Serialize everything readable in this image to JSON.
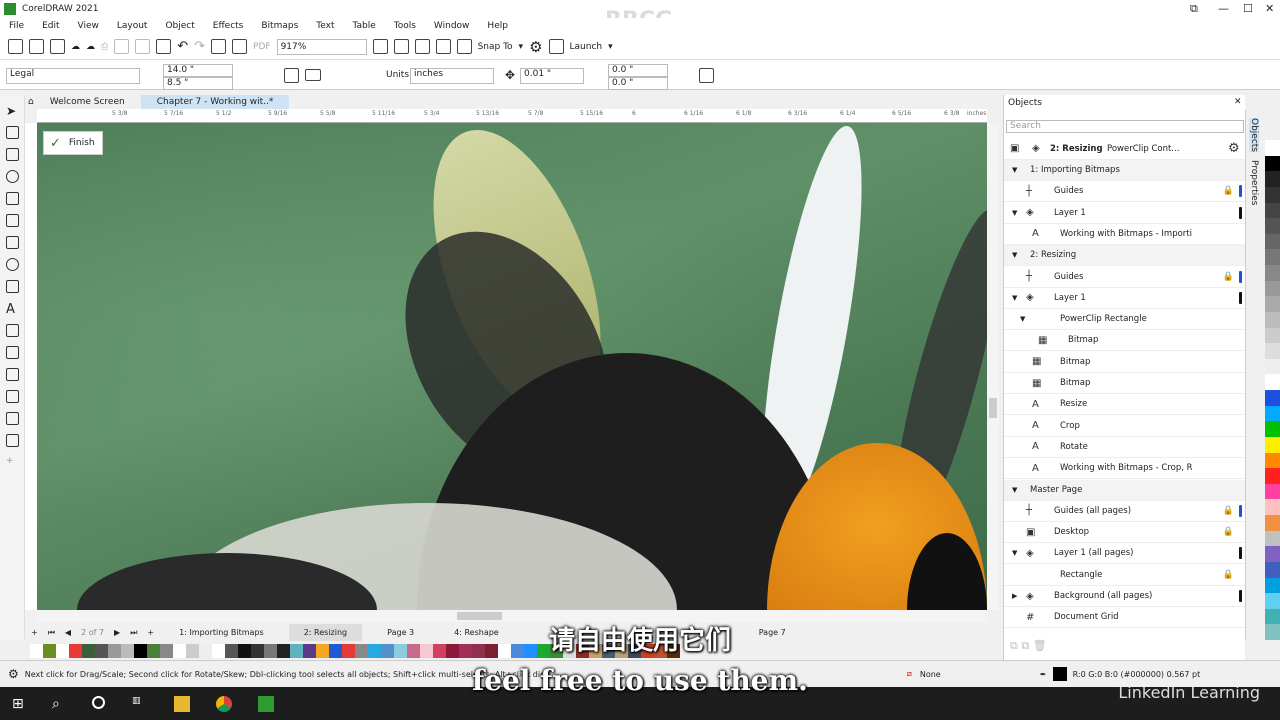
{
  "app": {
    "title": "CorelDRAW 2021",
    "watermark_top": "RRCG"
  },
  "menu": [
    "File",
    "Edit",
    "View",
    "Layout",
    "Object",
    "Effects",
    "Bitmaps",
    "Text",
    "Table",
    "Tools",
    "Window",
    "Help"
  ],
  "toolbar": {
    "zoom": "917%",
    "snap_to": "Snap To",
    "launch": "Launch"
  },
  "property_bar": {
    "page_size": "Legal",
    "width": "14.0 \"",
    "height": "8.5 \"",
    "units_label": "Units:",
    "units": "inches",
    "nudge": "0.01 \"",
    "dup_x": "0.0 \"",
    "dup_y": "0.0 \""
  },
  "doc_tabs": [
    "Welcome Screen",
    "Chapter 7 - Working wit..*"
  ],
  "ruler": [
    "5 3/8",
    "5 7/16",
    "5 1/2",
    "5 9/16",
    "5 5/8",
    "5 11/16",
    "5 3/4",
    "5 13/16",
    "5 7/8",
    "5 15/16",
    "6",
    "6 1/16",
    "6 1/8",
    "6 3/16",
    "6 1/4",
    "6 5/16",
    "6 3/8",
    "inches"
  ],
  "finish_button": "Finish",
  "pages": {
    "counter": "2 of 7",
    "tabs": [
      "1: Importing Bitmaps",
      "2: Resizing",
      "Page 3",
      "4: Reshape",
      "Page 7"
    ],
    "current": 1
  },
  "palette": [
    "#ffffff",
    "#6b8e23",
    "#ffffff",
    "#e53935",
    "#3a5f3a",
    "#555555",
    "#999999",
    "#bbbbbb",
    "#000000",
    "#4a7f3a",
    "#888888",
    "#ffffff",
    "#cccccc",
    "#eeeeee",
    "#ffffff",
    "#555555",
    "#111111",
    "#333333",
    "#777777",
    "#222222",
    "#5fb3c0",
    "#5b3a8a",
    "#f5a623",
    "#1e5ad8",
    "#e53935",
    "#888888",
    "#29a8e0",
    "#5590c8",
    "#88ccdd",
    "#c86b8a",
    "#f8c8d0",
    "#d04060",
    "#8b1a3a",
    "#a0305a",
    "#903050",
    "#7a2030",
    "#ffffff",
    "#4a8ad8",
    "#1e90ff",
    "#1fa830",
    "#3a8a3a",
    "#dddddd",
    "#8b2a2a",
    "#c8a060",
    "#4a5a70",
    "#b8a070",
    "#3a4a5a",
    "#d04020",
    "#c05030",
    "#5a2a10"
  ],
  "status": {
    "hint": "Next click for Drag/Scale; Second click for Rotate/Skew; Dbl-clicking tool selects all objects; Shift+click multi-selects; Alt+click digs",
    "fill": "None",
    "outline": "R:0 G:0 B:0 (#000000)  0.567 pt"
  },
  "objects_panel": {
    "title": "Objects",
    "search_placeholder": "Search",
    "current_page": "2: Resizing",
    "current_object": "PowerClip Cont...",
    "rows": [
      {
        "label": "1: Importing Bitmaps",
        "level": 0,
        "type": "page",
        "expand": "▼"
      },
      {
        "label": "Guides",
        "level": 1,
        "type": "guides",
        "bar": "#1e50e0",
        "lock": true
      },
      {
        "label": "Layer 1",
        "level": 1,
        "type": "layer",
        "expand": "▼",
        "bar": "#111111"
      },
      {
        "label": "Working with Bitmaps - Importi",
        "level": 2,
        "type": "text"
      },
      {
        "label": "2: Resizing",
        "level": 0,
        "type": "page",
        "expand": "▼"
      },
      {
        "label": "Guides",
        "level": 1,
        "type": "guides",
        "bar": "#1e50e0",
        "lock": true
      },
      {
        "label": "Layer 1",
        "level": 1,
        "type": "layer",
        "expand": "▼",
        "bar": "#111111"
      },
      {
        "label": "PowerClip Rectangle",
        "level": 2,
        "type": "none",
        "expand": "▼"
      },
      {
        "label": "Bitmap",
        "level": 3,
        "type": "bitmap"
      },
      {
        "label": "Bitmap",
        "level": 2,
        "type": "bitmap"
      },
      {
        "label": "Bitmap",
        "level": 2,
        "type": "bitmap"
      },
      {
        "label": "Resize",
        "level": 2,
        "type": "text"
      },
      {
        "label": "Crop",
        "level": 2,
        "type": "text"
      },
      {
        "label": "Rotate",
        "level": 2,
        "type": "text"
      },
      {
        "label": "Working with Bitmaps - Crop, R",
        "level": 2,
        "type": "text"
      },
      {
        "label": "Master Page",
        "level": 0,
        "type": "page",
        "expand": "▼"
      },
      {
        "label": "Guides (all pages)",
        "level": 1,
        "type": "guides",
        "bar": "#1e50e0",
        "lock": true
      },
      {
        "label": "Desktop",
        "level": 1,
        "type": "desktop",
        "lock": true
      },
      {
        "label": "Layer 1 (all pages)",
        "level": 1,
        "type": "layer",
        "expand": "▼",
        "bar": "#111111"
      },
      {
        "label": "Rectangle",
        "level": 2,
        "type": "none",
        "lock": true
      },
      {
        "label": "Background (all pages)",
        "level": 1,
        "type": "layer",
        "expand": "▶",
        "bar": "#111111"
      },
      {
        "label": "Document Grid",
        "level": 1,
        "type": "grid"
      }
    ]
  },
  "side_tabs": [
    "Objects",
    "Properties"
  ],
  "subtitles": {
    "chinese": "请自由使用它们",
    "english": "feel free to use them."
  },
  "branding": "LinkedIn Learning"
}
